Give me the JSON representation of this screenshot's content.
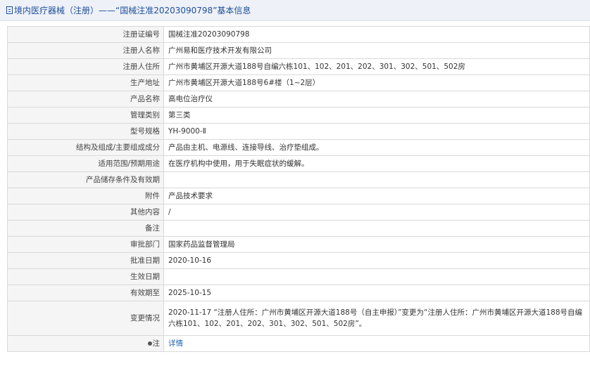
{
  "header": {
    "title": "境内医疗器械（注册）——“国械注准20203090798”基本信息"
  },
  "rows": [
    {
      "label": "注册证编号",
      "value": "国械注准20203090798"
    },
    {
      "label": "注册人名称",
      "value": "广州易和医疗技术开发有限公司"
    },
    {
      "label": "注册人住所",
      "value": "广州市黄埔区开源大道188号自编六栋101、102、201、202、301、302、501、502房"
    },
    {
      "label": "生产地址",
      "value": "广州市黄埔区开源大道188号6#楼（1~2层）"
    },
    {
      "label": "产品名称",
      "value": "高电位治疗仪"
    },
    {
      "label": "管理类别",
      "value": "第三类"
    },
    {
      "label": "型号规格",
      "value": "YH-9000-Ⅱ"
    },
    {
      "label": "结构及组成/主要组成成分",
      "value": "产品由主机、电源线、连接导线、治疗垫组成。"
    },
    {
      "label": "适用范围/预期用途",
      "value": "在医疗机构中使用，用于失眠症状的缓解。"
    },
    {
      "label": "产品储存条件及有效期",
      "value": ""
    },
    {
      "label": "附件",
      "value": "产品技术要求"
    },
    {
      "label": "其他内容",
      "value": "/"
    },
    {
      "label": "备注",
      "value": ""
    },
    {
      "label": "审批部门",
      "value": "国家药品监督管理局"
    },
    {
      "label": "批准日期",
      "value": "2020-10-16"
    },
    {
      "label": "生效日期",
      "value": ""
    },
    {
      "label": "有效期至",
      "value": "2025-10-15"
    },
    {
      "label": "变更情况",
      "value": "2020-11-17  “注册人住所：广州市黄埔区开源大道188号（自主申报）”变更为“注册人住所：广州市黄埔区开源大道188号自编六栋101、102、201、202、301、302、501、502房”。"
    }
  ],
  "note": {
    "label": "注",
    "link": "详情",
    "icon": "pin-icon"
  },
  "colors": {
    "header_bg": "#eef1f7",
    "header_text": "#1e4f9a",
    "label_bg": "#f5f5f5",
    "border": "#d9d9d9",
    "link": "#1e5fb0"
  }
}
